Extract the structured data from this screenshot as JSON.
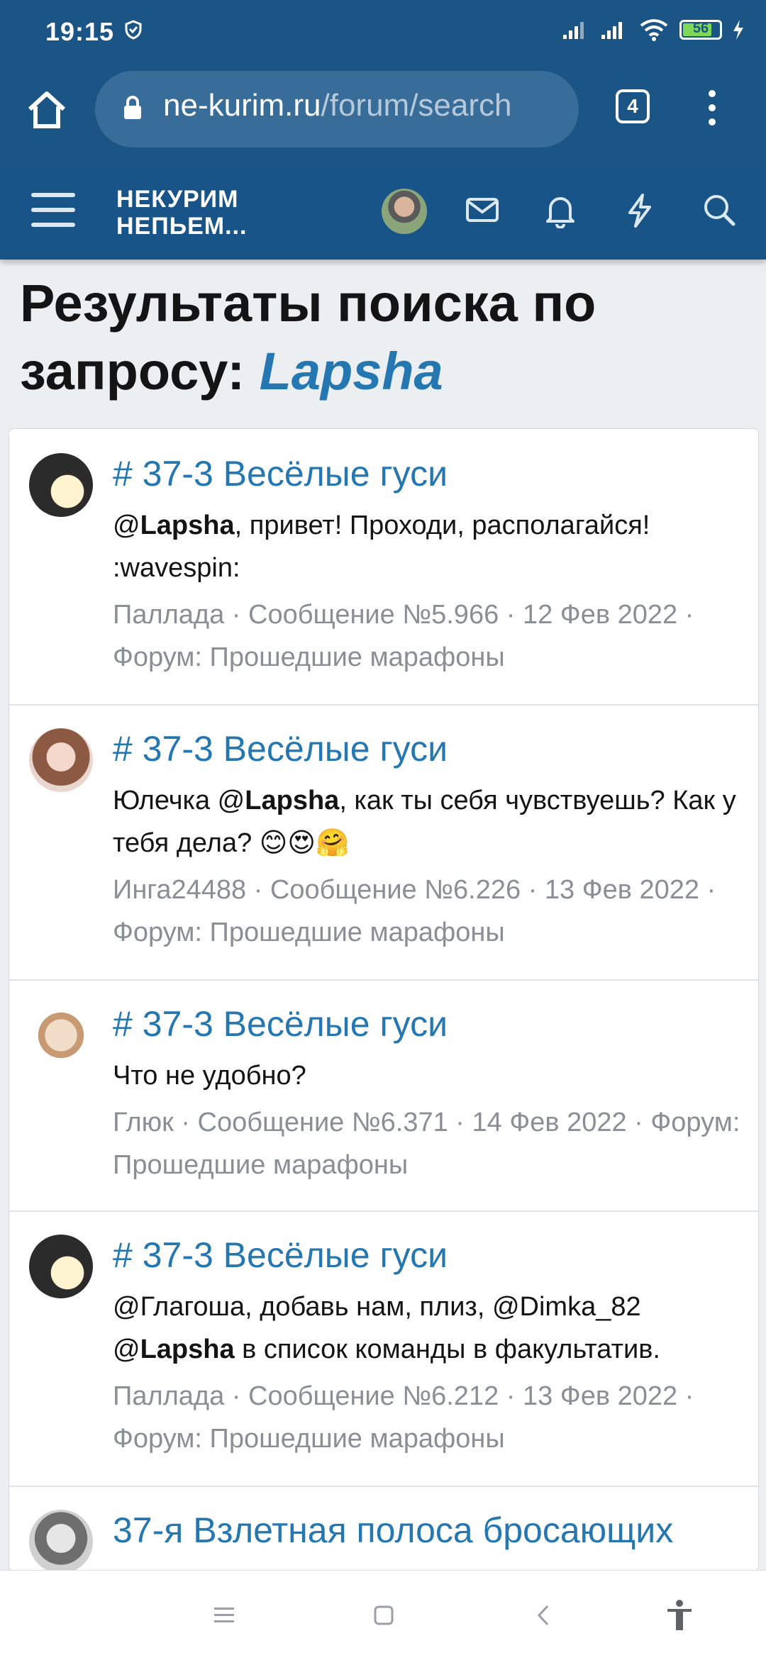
{
  "status_bar": {
    "time": "19:15",
    "battery": "56"
  },
  "browser": {
    "url_host": "ne-kurim.ru",
    "url_path": "/forum/search",
    "tab_count": "4"
  },
  "header": {
    "logo_line1": "НЕКУРИМ",
    "logo_line2": "НЕПЬЕМ..."
  },
  "page": {
    "title": "Результаты поиска по запросу:",
    "query": "Lapsha"
  },
  "results": [
    {
      "title": "# 37-3 Весёлые гуси",
      "pre": "@",
      "bold": "Lapsha",
      "post": ", привет! Проходи, располагайся! :wavespin:",
      "meta": "Паллада · Сообщение №5.966 · 12 Фев 2022 · Форум: Прошедшие марафоны"
    },
    {
      "title": "# 37-3 Весёлые гуси",
      "pre": "Юлечка @",
      "bold": "Lapsha",
      "post": ", как ты себя чувствуешь? Как у тебя дела? 😊😍🤗",
      "meta": "Инга24488 · Сообщение №6.226 · 13 Фев 2022 · Форум: Прошедшие марафоны"
    },
    {
      "title": "# 37-3 Весёлые гуси",
      "pre": "Что не удобно?",
      "bold": "",
      "post": "",
      "meta": "Глюк · Сообщение №6.371 · 14 Фев 2022 · Форум: Прошедшие марафоны"
    },
    {
      "title": "# 37-3 Весёлые гуси",
      "pre": "@Глагоша, добавь нам, плиз, @Dimka_82 @",
      "bold": "Lapsha",
      "post": " в список команды в факультатив.",
      "meta": "Паллада · Сообщение №6.212 · 13 Фев 2022 · Форум: Прошедшие марафоны"
    },
    {
      "title": "37-я Взлетная полоса бросающих",
      "pre": "",
      "bold": "",
      "post": "",
      "meta": ""
    }
  ],
  "icons": {
    "status": [
      "shield-icon",
      "signal-icon",
      "wifi-icon",
      "battery-icon",
      "charging-icon"
    ],
    "browser": [
      "home-icon",
      "lock-icon",
      "tabs-icon",
      "more-icon"
    ],
    "header": [
      "menu-icon",
      "avatar",
      "mail-icon",
      "bell-icon",
      "bolt-icon",
      "search-icon"
    ],
    "nav": [
      "recents-icon",
      "home-nav-icon",
      "back-icon",
      "accessibility-icon"
    ]
  },
  "colors": {
    "bar": "#185487",
    "link": "#2577b1",
    "meta": "#8a8f96"
  }
}
